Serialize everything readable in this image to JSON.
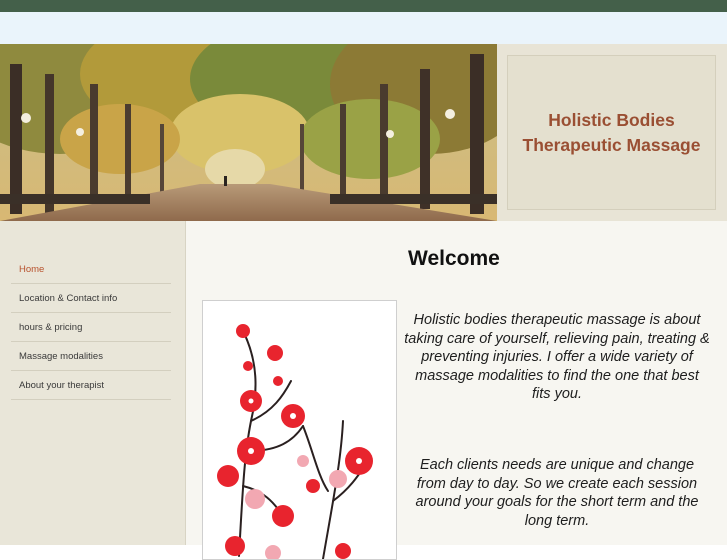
{
  "site": {
    "title_line1": "Holistic Bodies",
    "title_line2": "Therapeutic Massage"
  },
  "nav": {
    "items": [
      {
        "label": "Home",
        "active": true
      },
      {
        "label": "Location & Contact info",
        "active": false
      },
      {
        "label": "hours & pricing",
        "active": false
      },
      {
        "label": "Massage modalities",
        "active": false
      },
      {
        "label": "About your therapist",
        "active": false
      }
    ]
  },
  "main": {
    "heading": "Welcome",
    "paragraph1": "Holistic bodies therapeutic massage is about taking care of yourself, relieving pain, treating & preventing injuries.  I offer a wide variety of massage modalities to find the one that best fits you.",
    "paragraph2": "Each clients needs are unique and change from day to day. So we create each session around your goals for the short term and the long term."
  },
  "colors": {
    "topbar": "#44604a",
    "title": "#9a4f33",
    "nav_active": "#b8532e",
    "blossom": "#e8242e"
  },
  "images": {
    "banner": "park-walkway-autumn-trees",
    "side_image": "cherry-blossom-branch"
  }
}
